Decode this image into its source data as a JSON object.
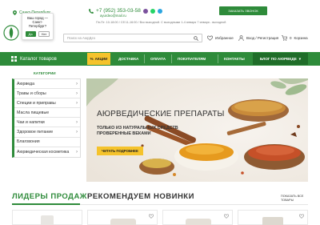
{
  "colors": {
    "accent": "#2e8b3a",
    "accent_dark": "#1f6d29",
    "promo": "#f5c32c"
  },
  "topbar": {
    "city": "Санкт-Петербург",
    "city_prompt": "Ваш город — Санкт-Петербург?",
    "yes": "Да",
    "no": "Нет",
    "phone": "+7 (952) 353-03-58",
    "email": "ayurdeo@mail.ru",
    "hours": "Пн-Пт: 10-18:00 / Сб 11-16:00 / Вск выходной. С выходными 1-4 января 7 января - выходной",
    "callback": "ЗАКАЗАТЬ ЗВОНОК"
  },
  "header": {
    "search_placeholder": "Поиск на АюрДеэ",
    "favorites": "Избранное",
    "login": "Вход / Регистрация",
    "cart_count": "0",
    "cart": "Корзина"
  },
  "nav": {
    "catalog": "Каталог товаров",
    "promo": "АКЦИИ",
    "items": [
      "ДОСТАВКА",
      "ОПЛАТА",
      "ПОКУПАТЕЛЯМ",
      "КОНТАКТЫ"
    ],
    "blog": "БЛОГ ПО АЮРВЕДЕ"
  },
  "sidebar": {
    "title": "КАТЕГОРИИ",
    "items": [
      {
        "label": "Аюрведа",
        "arrow": "›"
      },
      {
        "label": "Травы и сборы",
        "arrow": "›"
      },
      {
        "label": "Специи и приправы",
        "arrow": "›"
      },
      {
        "label": "Масла пищевые",
        "arrow": ""
      },
      {
        "label": "Чаи и напитки",
        "arrow": "›"
      },
      {
        "label": "Здоровое питание",
        "arrow": "›"
      },
      {
        "label": "Благовония",
        "arrow": ""
      },
      {
        "label": "Аюрведическая косметика",
        "arrow": "›"
      }
    ]
  },
  "banner": {
    "title": "АЮРВЕДИЧЕСКИЕ ПРЕПАРАТЫ",
    "subtitle_1": "ТОЛЬКО ИЗ НАТУРАЛЬНЫХ СРЕДСТВ",
    "subtitle_2": "ПРОВЕРЕННЫЕ ВЕКАМИ",
    "button": "ЧИТАТЬ ПОДРОБНЕЕ"
  },
  "products": {
    "tabs": [
      "ЛИДЕРЫ ПРОДАЖ",
      "РЕКОМЕНДУЕМ",
      "НОВИНКИ"
    ],
    "show_all_1": "ПОКАЗАТЬ ВСЕ",
    "show_all_2": "ТОВАРЫ"
  }
}
